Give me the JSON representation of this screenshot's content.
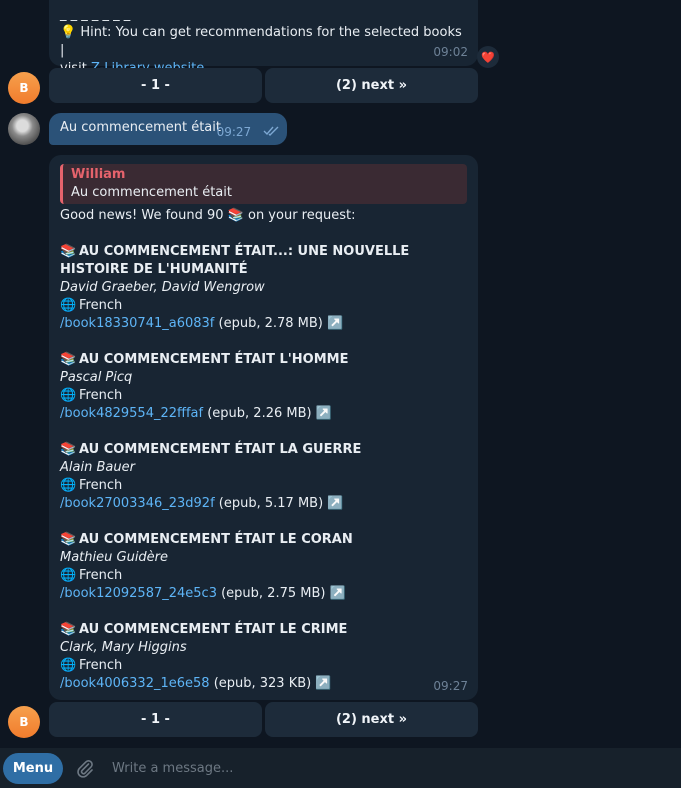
{
  "messages": {
    "hint_message": {
      "dashes": "_ _ _ _ _ _ _",
      "hint_emoji": "💡",
      "hint_text": "Hint: You can get recommendations for the selected books |",
      "visit_text": "visit",
      "link_text": "Z-Library website",
      "time": "09:02",
      "reaction": "❤️"
    },
    "user_query": {
      "text": "Au commencement était",
      "time": "09:27",
      "status": "✓✓"
    },
    "results": {
      "reply_name": "William",
      "reply_text": "Au commencement était",
      "intro_before": "Good news! We found 90",
      "intro_emoji": "📚",
      "intro_after": "on your request:",
      "time": "09:27",
      "books": [
        {
          "emoji": "📚",
          "title": "AU COMMENCEMENT ÉTAIT...: UNE NOUVELLE HISTOIRE DE L'HUMANITÉ",
          "authors": "David Graeber, David Wengrow",
          "lang_emoji": "🌐",
          "language": "French",
          "link": "/book18330741_a6083f",
          "meta": "(epub, 2.78 MB)",
          "arrow": "↗️"
        },
        {
          "emoji": "📚",
          "title": "AU COMMENCEMENT ÉTAIT L'HOMME",
          "authors": "Pascal Picq",
          "lang_emoji": "🌐",
          "language": "French",
          "link": "/book4829554_22fffaf",
          "meta": "(epub, 2.26 MB)",
          "arrow": "↗️"
        },
        {
          "emoji": "📚",
          "title": "AU COMMENCEMENT ÉTAIT LA GUERRE",
          "authors": "Alain Bauer",
          "lang_emoji": "🌐",
          "language": "French",
          "link": "/book27003346_23d92f",
          "meta": "(epub, 5.17 MB)",
          "arrow": "↗️"
        },
        {
          "emoji": "📚",
          "title": "AU COMMENCEMENT ÉTAIT LE CORAN",
          "authors": "Mathieu Guidère",
          "lang_emoji": "🌐",
          "language": "French",
          "link": "/book12092587_24e5c3",
          "meta": "(epub, 2.75 MB)",
          "arrow": "↗️"
        },
        {
          "emoji": "📚",
          "title": "AU COMMENCEMENT ÉTAIT LE CRIME",
          "authors": "Clark, Mary Higgins",
          "lang_emoji": "🌐",
          "language": "French",
          "link": "/book4006332_1e6e58",
          "meta": "(epub, 323 KB)",
          "arrow": "↗️"
        }
      ]
    }
  },
  "keyboard_top": {
    "page_label": "- 1 -",
    "next_label": "(2) next »"
  },
  "keyboard_bottom": {
    "page_label": "- 1 -",
    "next_label": "(2) next »"
  },
  "avatars": {
    "bot_letter": "B"
  },
  "input": {
    "menu_label": "Menu",
    "placeholder": "Write a message..."
  },
  "colors": {
    "background": "#0e1621",
    "incoming": "#182533",
    "outgoing": "#2b5278",
    "link": "#5eb5f7",
    "accent_orange": "#f17c2d",
    "reply_red": "#e5636c"
  }
}
